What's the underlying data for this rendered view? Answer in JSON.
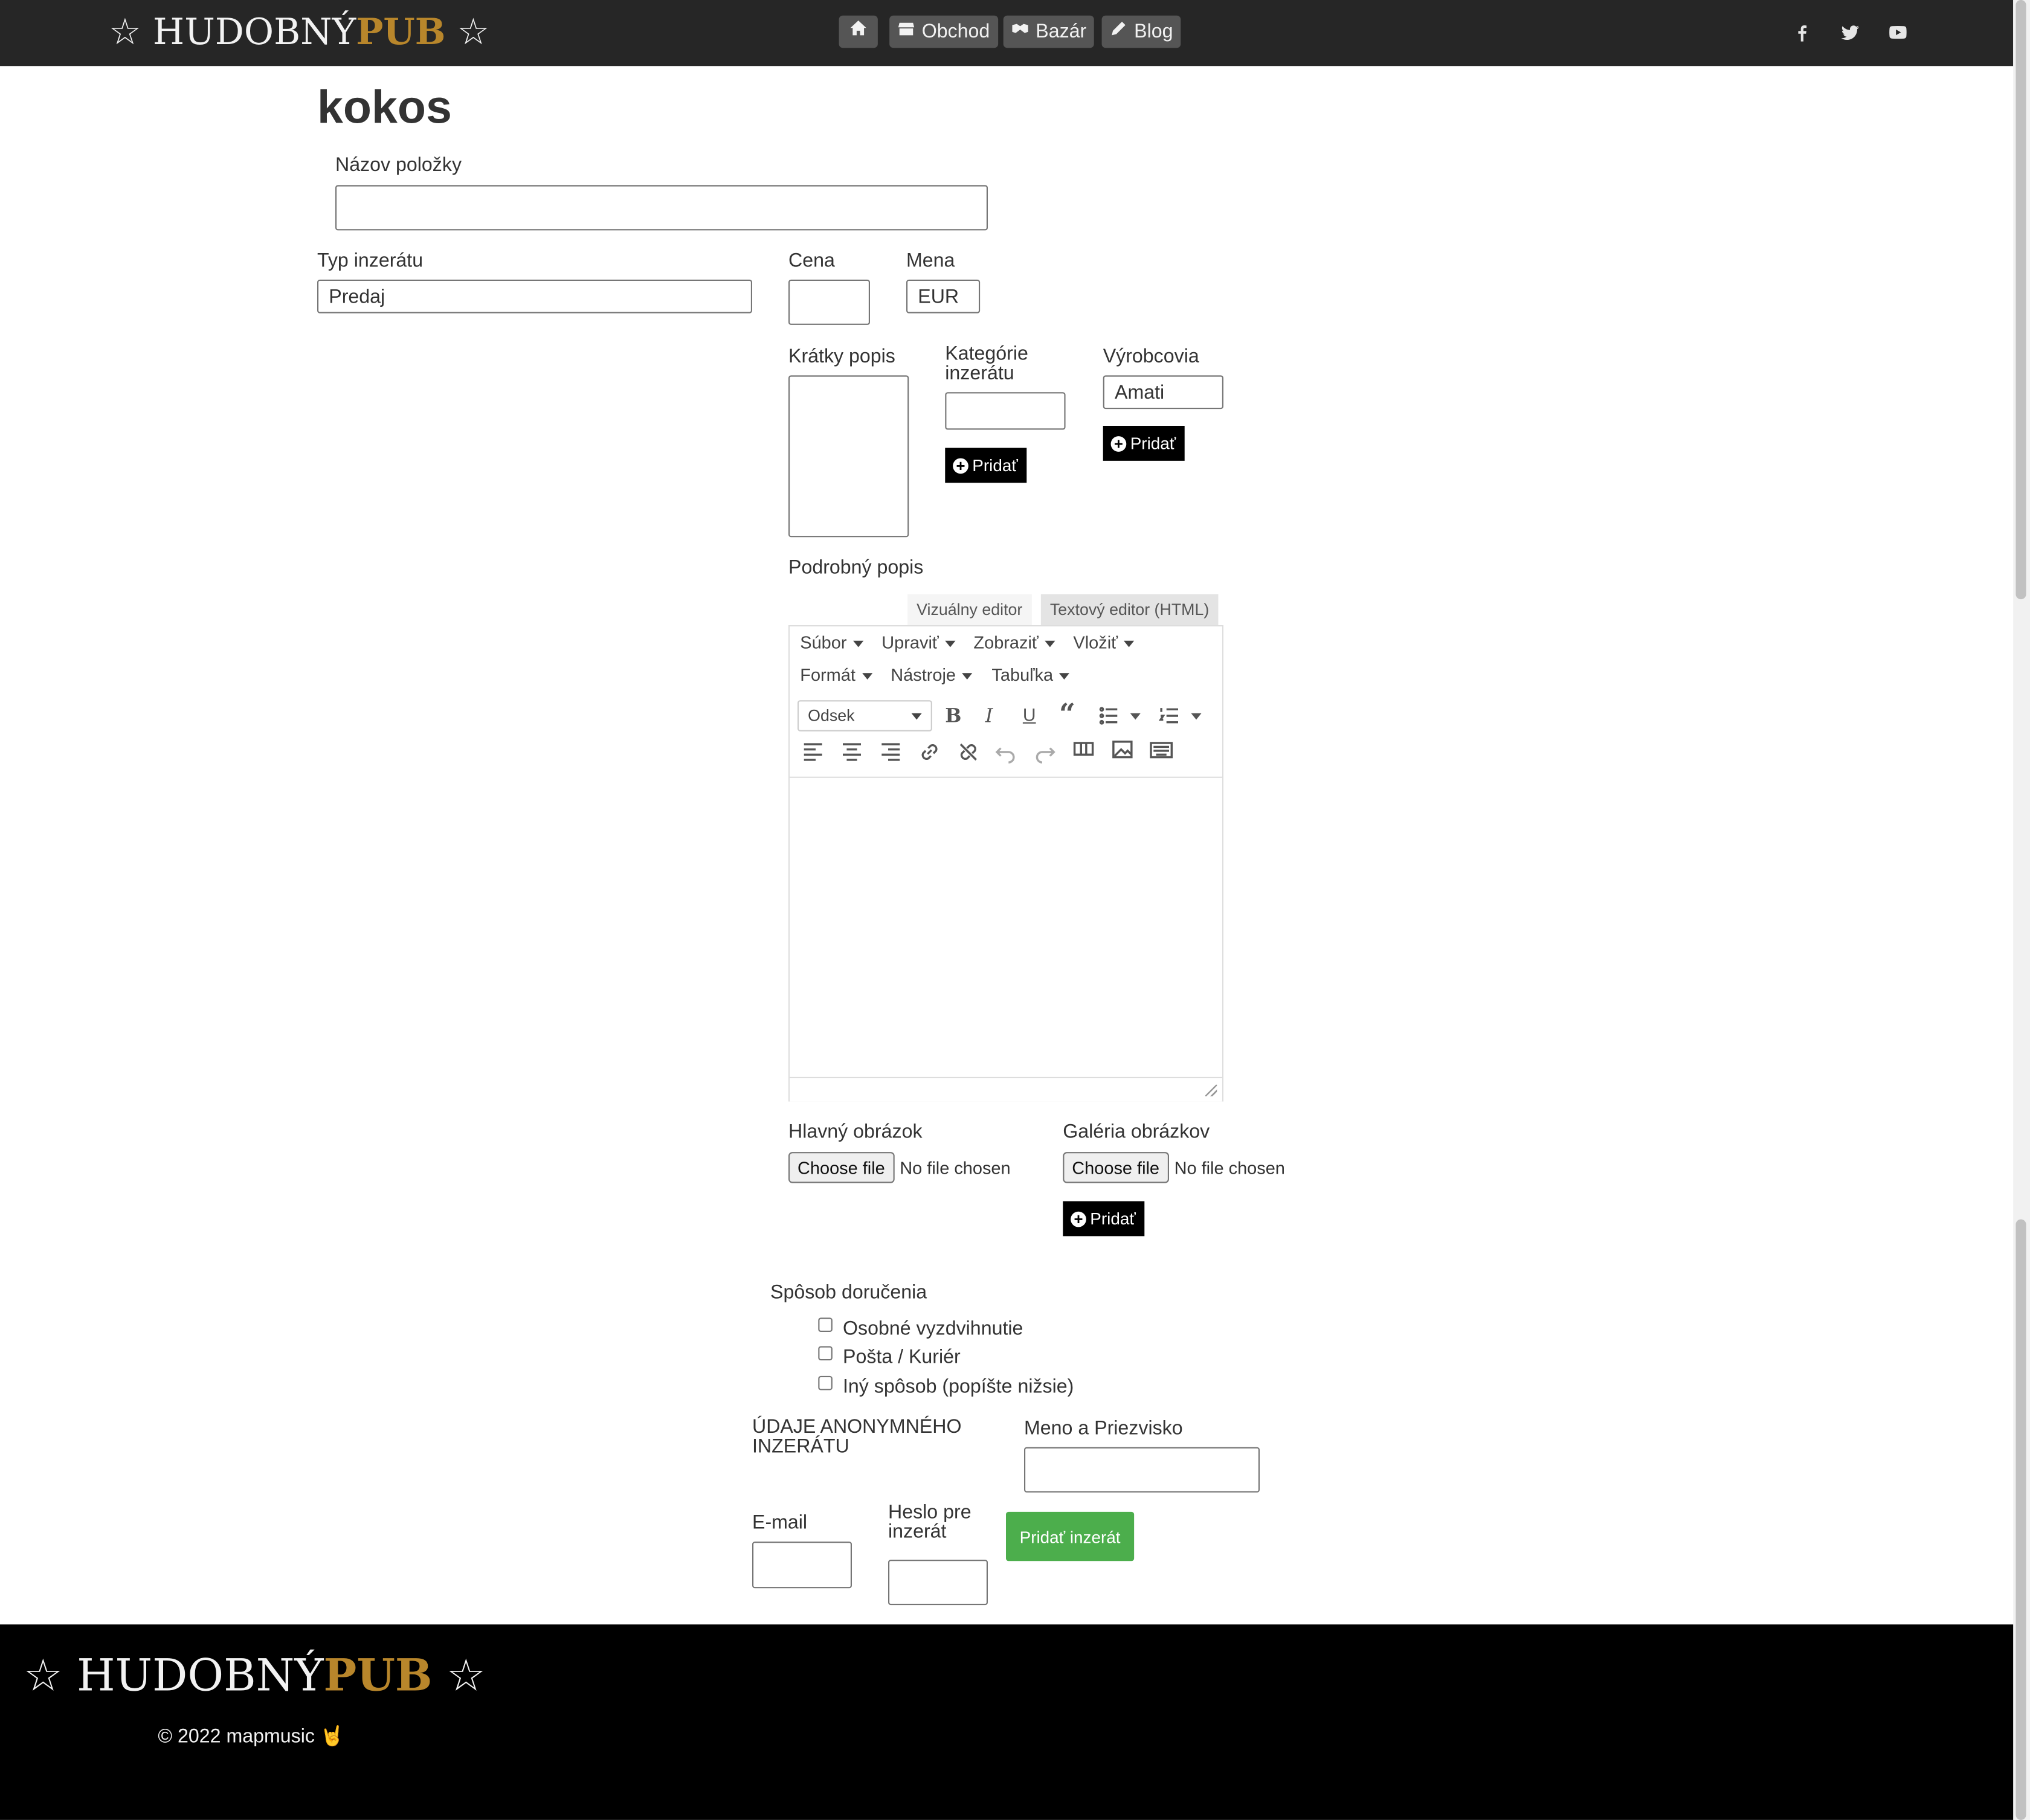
{
  "header": {
    "logo_left_word": "HUDOBNÝ",
    "logo_right_word": "PUB",
    "nav": [
      {
        "label": "",
        "icon": "home-icon"
      },
      {
        "label": "Obchod",
        "icon": "store-icon"
      },
      {
        "label": "Bazár",
        "icon": "handshake-icon"
      },
      {
        "label": "Blog",
        "icon": "pen-icon"
      }
    ],
    "social": [
      "facebook-icon",
      "twitter-icon",
      "youtube-icon"
    ],
    "brand_accent": "#b8862b"
  },
  "page": {
    "title": "kokos"
  },
  "form": {
    "item_name_label": "Názov položky",
    "item_name_value": "",
    "ad_type_label": "Typ inzerátu",
    "ad_type_value": "Predaj",
    "price_label": "Cena",
    "price_value": "",
    "currency_label": "Mena",
    "currency_value": "EUR",
    "short_desc_label": "Krátky popis",
    "categories_label_line1": "Kategórie",
    "categories_label_line2": "inzerátu",
    "manufacturers_label": "Výrobcovia",
    "manufacturers_value": "Amati",
    "add_label": "Pridať",
    "detail_desc_label": "Podrobný popis",
    "main_image_label": "Hlavný obrázok",
    "gallery_label": "Galéria obrázkov",
    "choose_file": "Choose file",
    "no_file": "No file chosen",
    "delivery_label": "Spôsob doručenia",
    "delivery_options": [
      "Osobné vyzdvihnutie",
      "Pošta / Kuriér",
      "Iný spôsob (popíšte nižsie)"
    ],
    "anon_line1": "ÚDAJE ANONYMNÉHO",
    "anon_line2": "INZERÁTU",
    "name_label": "Meno a Priezvisko",
    "email_label": "E-mail",
    "password_label_line1": "Heslo pre",
    "password_label_line2": "inzerát",
    "submit_label": "Pridať inzerát",
    "submit_color": "#4cae4c"
  },
  "editor": {
    "tab_visual": "Vizuálny editor",
    "tab_text": "Textový editor (HTML)",
    "menu_row1": [
      "Súbor",
      "Upraviť",
      "Zobraziť",
      "Vložiť"
    ],
    "menu_row2": [
      "Formát",
      "Nástroje",
      "Tabuľka"
    ],
    "format_select": "Odsek",
    "toolbar_icons": [
      "bold-icon",
      "italic-icon",
      "underline-icon",
      "blockquote-icon",
      "bullet-list-icon",
      "numbered-list-icon",
      "align-left-icon",
      "align-center-icon",
      "align-right-icon",
      "link-icon",
      "unlink-icon",
      "undo-icon",
      "redo-icon",
      "read-more-icon",
      "image-icon",
      "keyboard-icon"
    ]
  },
  "footer": {
    "logo_left_word": "HUDOBNÝ",
    "logo_right_word": "PUB",
    "copyright": "© 2022 mapmusic",
    "emoji": "🤘"
  }
}
